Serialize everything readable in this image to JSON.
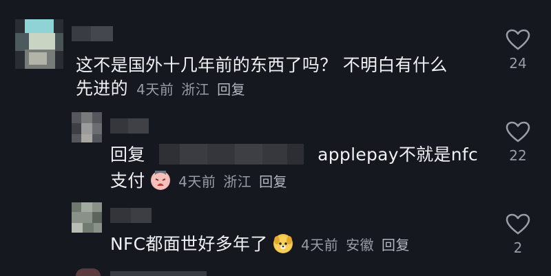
{
  "comments": [
    {
      "text_line1": "这不是国外十几年前的东西了吗？ 不明白有什么",
      "text_line2": "先进的",
      "time": "4天前",
      "location": "浙江",
      "reply_label": "回复",
      "likes": "24",
      "icon": "heart-outline-icon"
    },
    {
      "prefix": "回复",
      "text_after_mention": "applepay不就是nfc",
      "text_line2": "支付",
      "emoji": "crying-emoji",
      "time": "4天前",
      "location": "浙江",
      "reply_label": "回复",
      "likes": "22",
      "icon": "heart-outline-icon"
    },
    {
      "text": "NFC都面世好多年了",
      "emoji": "dog-emoji",
      "time": "4天前",
      "location": "安徽",
      "reply_label": "回复",
      "likes": "2",
      "icon": "heart-outline-icon"
    }
  ],
  "colors": {
    "background": "#16181f",
    "text": "#f0f1f4",
    "meta": "#9a9ca6"
  }
}
